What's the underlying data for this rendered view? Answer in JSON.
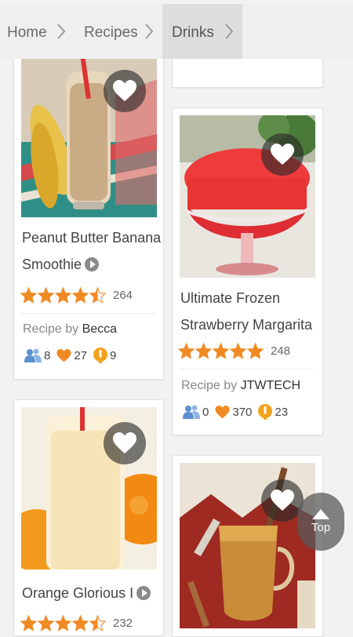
{
  "breadcrumb": [
    "Home",
    "Recipes",
    "Drinks"
  ],
  "cards": [
    {
      "title_line1": "Peanut Butter Banana",
      "title_line2": "Smoothie",
      "rating": 4.5,
      "review_count": "264",
      "recipe_by_label": "Recipe by",
      "author": "Becca",
      "made_count": "8",
      "favorites": "27",
      "tips": "9"
    },
    {
      "title_line1": "Ultimate Frozen",
      "title_line2": "Strawberry Margarita",
      "rating": 5,
      "review_count": "248",
      "recipe_by_label": "Recipe by",
      "author": "JTWTECH",
      "made_count": "0",
      "favorites": "370",
      "tips": "23"
    },
    {
      "title_line1": "Orange Glorious I",
      "rating": 4.5,
      "review_count": "232"
    },
    {
      "title_line1": ""
    }
  ],
  "top_button": "Top",
  "colors": {
    "star": "#f08a24",
    "heart": "#f08a24",
    "made_icon": "#5b8fd0",
    "tip_icon": "#f3a21d"
  },
  "icons": [
    "heart-icon",
    "play-icon",
    "star-icon",
    "made-it-icon",
    "tip-icon",
    "arrow-up-icon",
    "chevron-right-icon"
  ]
}
